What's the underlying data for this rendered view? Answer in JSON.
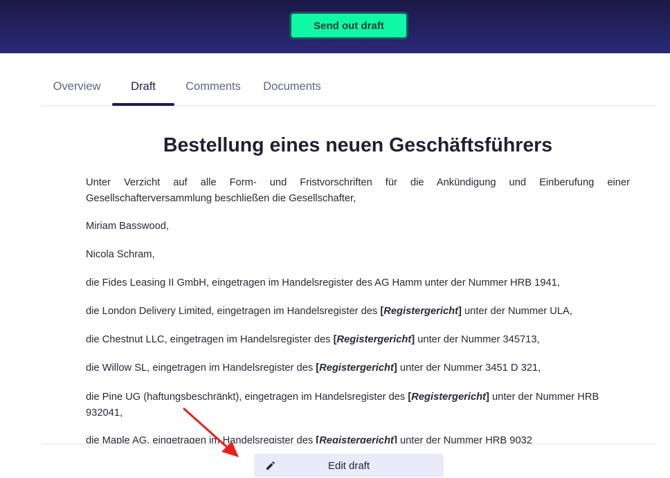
{
  "header": {
    "send_label": "Send out draft",
    "accent_color": "#10f7a8"
  },
  "tabs": [
    {
      "label": "Overview",
      "active": false
    },
    {
      "label": "Draft",
      "active": true
    },
    {
      "label": "Comments",
      "active": false
    },
    {
      "label": "Documents",
      "active": false
    }
  ],
  "document": {
    "title": "Bestellung eines neuen Geschäftsführers",
    "intro": "Unter Verzicht auf alle Form- und Fristvorschriften für die Ankündigung und Einberufung einer Gesellschafterversammlung beschließen die Gesellschafter,",
    "shareholder_1": "Miriam Basswood,",
    "shareholder_2": "Nicola Schram,",
    "fides": "die Fides Leasing II GmbH, eingetragen im Handelsregister des AG Hamm unter der Nummer HRB 1941,",
    "placeholder": "Registergericht",
    "london_pre": "die London Delivery Limited, eingetragen im Handelsregister des ",
    "london_post": " unter der Nummer ULA,",
    "chestnut_pre": "die Chestnut LLC, eingetragen im Handelsregister des ",
    "chestnut_post": " unter der Nummer 345713,",
    "willow_pre": "die Willow SL, eingetragen im Handelsregister des ",
    "willow_post": " unter der Nummer 3451 D 321,",
    "pine_pre": "die Pine UG (haftungsbeschränkt), eingetragen im Handelsregister des ",
    "pine_post": " unter der Nummer HRB 932041,",
    "maple_pre": "die Maple AG, eingetragen im Handelsregister des ",
    "maple_post": " unter der Nummer HRB 9032"
  },
  "footer": {
    "edit_label": "Edit draft",
    "edit_icon": "pencil-icon"
  },
  "annotation": {
    "arrow_color": "#e8201c"
  }
}
